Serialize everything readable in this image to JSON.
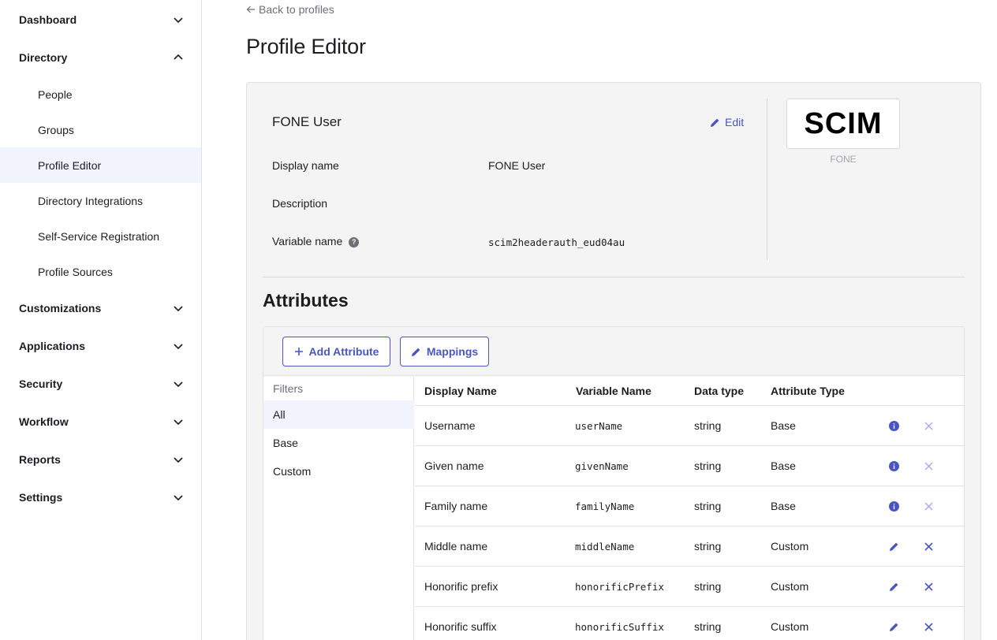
{
  "sidebar": {
    "sections": [
      {
        "label": "Dashboard",
        "expanded": false
      },
      {
        "label": "Directory",
        "expanded": true
      },
      {
        "label": "Customizations",
        "expanded": false
      },
      {
        "label": "Applications",
        "expanded": false
      },
      {
        "label": "Security",
        "expanded": false
      },
      {
        "label": "Workflow",
        "expanded": false
      },
      {
        "label": "Reports",
        "expanded": false
      },
      {
        "label": "Settings",
        "expanded": false
      }
    ],
    "directory_items": [
      {
        "label": "People"
      },
      {
        "label": "Groups"
      },
      {
        "label": "Profile Editor",
        "active": true
      },
      {
        "label": "Directory Integrations"
      },
      {
        "label": "Self-Service Registration"
      },
      {
        "label": "Profile Sources"
      }
    ]
  },
  "header": {
    "back_label": "Back to profiles",
    "title": "Profile Editor"
  },
  "profile": {
    "name": "FONE User",
    "edit_label": "Edit",
    "fields": [
      {
        "label": "Display name",
        "value": "FONE User"
      },
      {
        "label": "Description",
        "value": ""
      },
      {
        "label": "Variable name",
        "value": "scim2headerauth_eud04au"
      }
    ],
    "logo_text": "SCIM",
    "logo_caption": "FONE"
  },
  "attributes": {
    "title": "Attributes",
    "add_label": "Add Attribute",
    "mappings_label": "Mappings",
    "filters_title": "Filters",
    "filters": [
      "All",
      "Base",
      "Custom"
    ],
    "active_filter": "All",
    "columns": [
      "Display Name",
      "Variable Name",
      "Data type",
      "Attribute Type"
    ],
    "rows": [
      {
        "display": "Username",
        "variable": "userName",
        "type": "string",
        "attr_type": "Base",
        "action": "info-icon"
      },
      {
        "display": "Given name",
        "variable": "givenName",
        "type": "string",
        "attr_type": "Base",
        "action": "info-icon"
      },
      {
        "display": "Family name",
        "variable": "familyName",
        "type": "string",
        "attr_type": "Base",
        "action": "info-icon"
      },
      {
        "display": "Middle name",
        "variable": "middleName",
        "type": "string",
        "attr_type": "Custom",
        "action": "pencil-icon"
      },
      {
        "display": "Honorific prefix",
        "variable": "honorificPrefix",
        "type": "string",
        "attr_type": "Custom",
        "action": "pencil-icon"
      },
      {
        "display": "Honorific suffix",
        "variable": "honorificSuffix",
        "type": "string",
        "attr_type": "Custom",
        "action": "pencil-icon"
      }
    ]
  },
  "colors": {
    "accent": "#4a55c5",
    "muted": "#6e6e78",
    "active_bg": "#f1f3fd",
    "panel_bg": "#f4f4f4",
    "delete_disabled": "#a9aee6"
  }
}
